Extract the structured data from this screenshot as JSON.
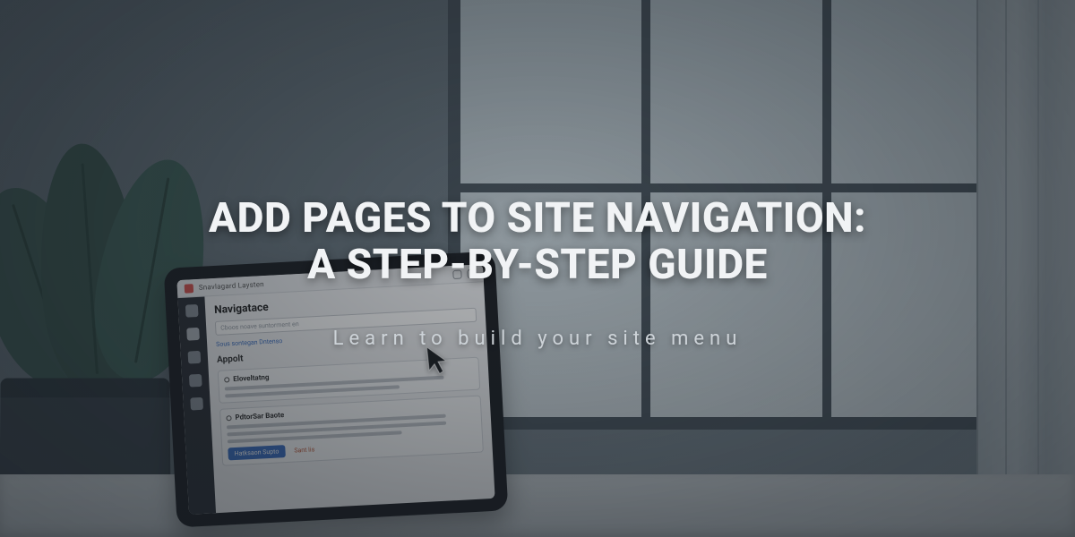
{
  "hero": {
    "title_line1": "ADD PAGES TO SITE NAVIGATION:",
    "title_line2": "A STEP-BY-STEP GUIDE",
    "subtitle": "Learn to build your site menu"
  },
  "tablet": {
    "topbar_label": "Snavlagard Laysten",
    "panel_heading": "Navigatace",
    "input_placeholder": "Cboos noave suntorment en",
    "helper_link": "Sous sontegan Dntenso",
    "subheading": "Appolt",
    "card1_title": "Eloveltatng",
    "card2_title": "PdtorSar Baote",
    "primary_button": "Hatksaon Supto",
    "ghost_button": "Sant lis"
  }
}
